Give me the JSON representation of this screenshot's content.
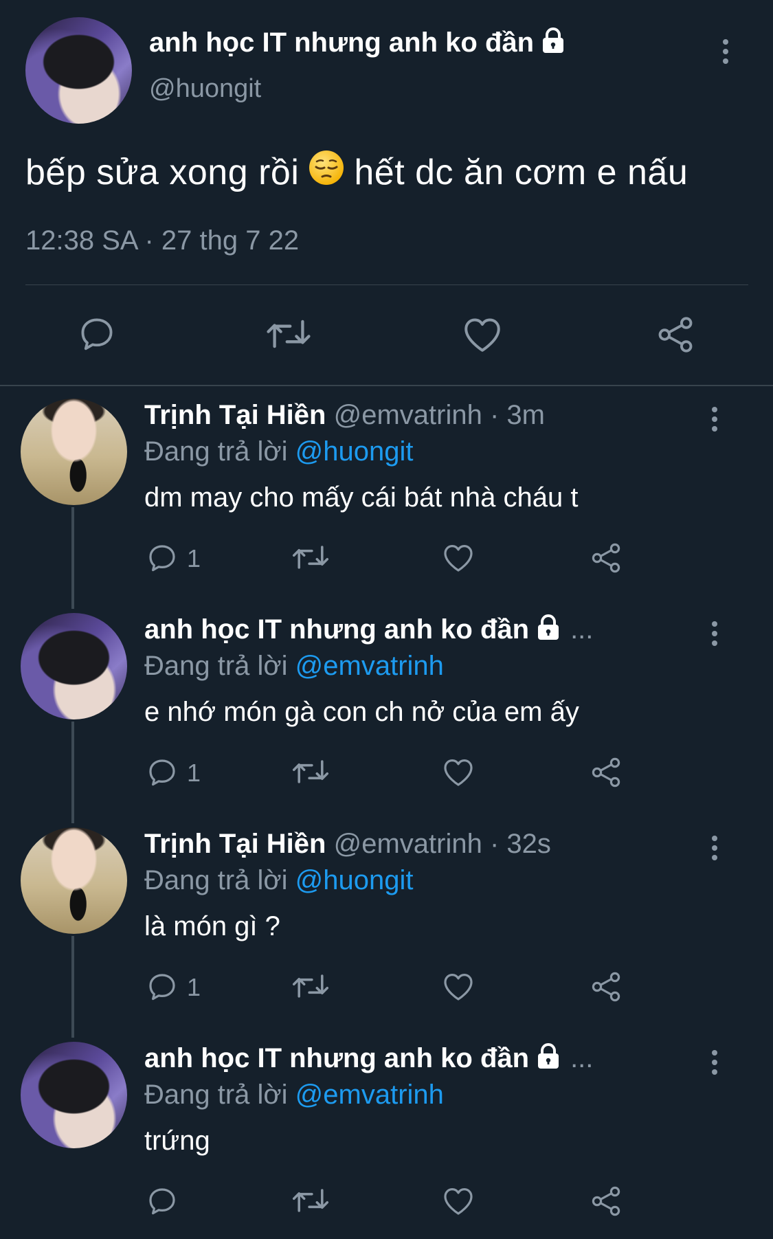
{
  "tweet": {
    "author_name": "anh học IT nhưng anh ko đần",
    "author_handle": "@huongit",
    "text_before_emoji": "bếp sửa xong rồi",
    "emoji": "pensive-face",
    "text_after_emoji": "hết dc ăn cơm e nấu",
    "timestamp": "12:38 SA · 27 thg 7 22",
    "actions": [
      "reply",
      "retweet",
      "like",
      "share"
    ]
  },
  "replies": [
    {
      "author_name": "Trịnh Tại Hiền",
      "meta": "@emvatrinh · 3m",
      "replying_prefix": "Đang trả lời",
      "replying_to": "@huongit",
      "text": "dm may cho mấy cái bát nhà cháu t",
      "reply_count": "1",
      "avatar": "trinh"
    },
    {
      "author_name": "anh học IT nhưng anh ko đần",
      "meta": "",
      "truncation": "...",
      "replying_prefix": "Đang trả lời",
      "replying_to": "@emvatrinh",
      "text": "e nhớ món gà con ch nở của em ấy",
      "reply_count": "1",
      "avatar": "masked"
    },
    {
      "author_name": "Trịnh Tại Hiền",
      "meta": "@emvatrinh · 32s",
      "replying_prefix": "Đang trả lời",
      "replying_to": "@huongit",
      "text": "là món gì ?",
      "reply_count": "1",
      "avatar": "trinh"
    },
    {
      "author_name": "anh học IT nhưng anh ko đần",
      "meta": "",
      "truncation": "...",
      "replying_prefix": "Đang trả lời",
      "replying_to": "@emvatrinh",
      "text": "trứng",
      "reply_count": "",
      "avatar": "masked"
    }
  ],
  "colors": {
    "background": "#15202b",
    "secondary_text": "#8b98a5",
    "link": "#1d9bf0",
    "divider": "#38444d"
  }
}
